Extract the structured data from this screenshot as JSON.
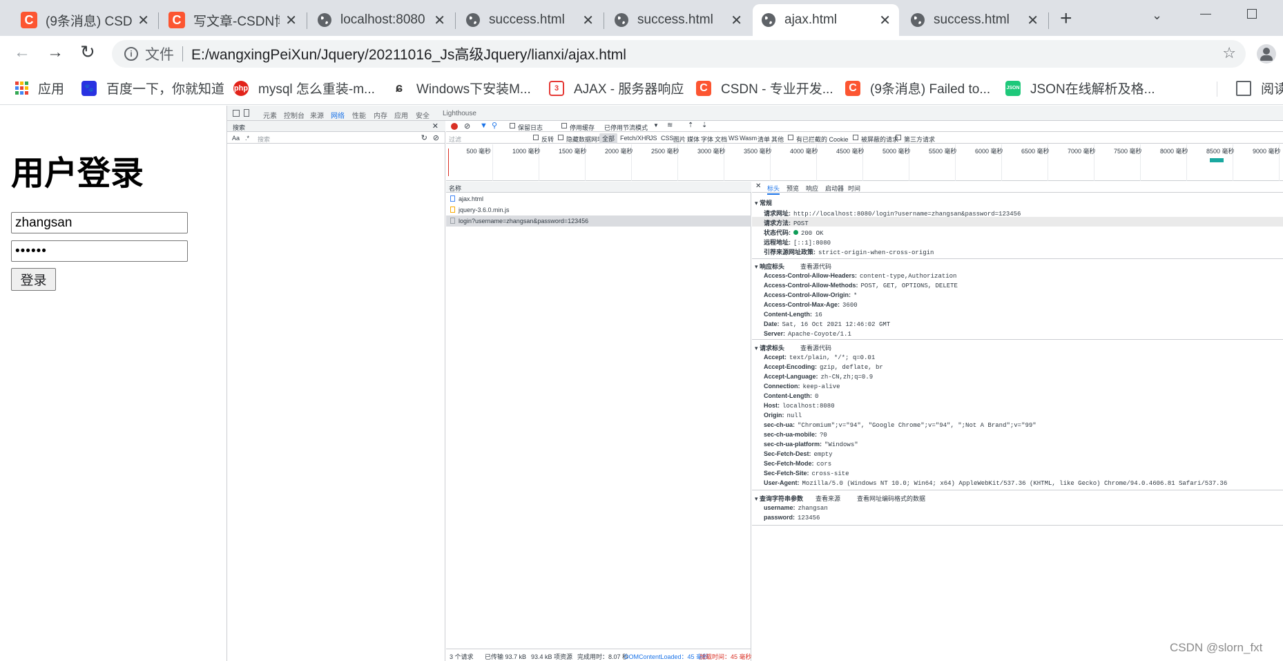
{
  "tabs": [
    {
      "title": "(9条消息) CSDN",
      "icon": "csdn-icon"
    },
    {
      "title": "写文章-CSDN博客",
      "icon": "csdn-icon"
    },
    {
      "title": "localhost:8080",
      "icon": "globe-icon"
    },
    {
      "title": "success.html",
      "icon": "globe-icon"
    },
    {
      "title": "success.html",
      "icon": "globe-icon"
    },
    {
      "title": "ajax.html",
      "icon": "globe-icon"
    },
    {
      "title": "success.html",
      "icon": "globe-icon"
    }
  ],
  "address": {
    "scheme_label": "文件",
    "url": "E:/wangxingPeiXun/Jquery/20211016_Js高级Jquery/lianxi/ajax.html"
  },
  "bookmarks": [
    {
      "label": "应用"
    },
    {
      "label": "百度一下，你就知道"
    },
    {
      "label": "mysql 怎么重装-m..."
    },
    {
      "label": "Windows下安装M..."
    },
    {
      "label": "AJAX - 服务器响应"
    },
    {
      "label": "CSDN - 专业开发..."
    },
    {
      "label": "(9条消息) Failed to..."
    },
    {
      "label": "JSON在线解析及格..."
    },
    {
      "label": "阅读"
    }
  ],
  "page": {
    "heading": "用户登录",
    "username": "zhangsan",
    "password": "••••••",
    "login_button": "登录"
  },
  "devtools": {
    "panels": [
      "元素",
      "控制台",
      "来源",
      "网络",
      "性能",
      "内存",
      "应用",
      "安全",
      "Lighthouse"
    ],
    "search_tab": "搜索",
    "search_case": "Aa",
    "search_regex": ".*",
    "search_placeholder": "搜索",
    "options": {
      "preserve_log": "保留日志",
      "disable_cache": "停用缓存",
      "throttle": "已停用节流模式"
    },
    "filter_placeholder": "过滤",
    "filter_types": {
      "invert": "反转",
      "hide_data": "隐藏数据网址",
      "all": "全部",
      "types": [
        "Fetch/XHR",
        "JS",
        "CSS",
        "图片",
        "媒体",
        "字体",
        "文档",
        "WS",
        "Wasm",
        "清单",
        "其他"
      ],
      "blocked_cookies": "有已拦截的 Cookie",
      "blocked_requests": "被屏蔽的请求",
      "third_party": "第三方请求"
    },
    "timeline_ticks": [
      "500 毫秒",
      "1000 毫秒",
      "1500 毫秒",
      "2000 毫秒",
      "2500 毫秒",
      "3000 毫秒",
      "3500 毫秒",
      "4000 毫秒",
      "4500 毫秒",
      "5000 毫秒",
      "5500 毫秒",
      "6000 毫秒",
      "6500 毫秒",
      "7000 毫秒",
      "7500 毫秒",
      "8000 毫秒",
      "8500 毫秒",
      "9000 毫秒"
    ],
    "requests_header": "名称",
    "requests": [
      "ajax.html",
      "jquery-3.6.0.min.js",
      "login?username=zhangsan&password=123456"
    ],
    "status_bar": [
      "3 个请求",
      "已传输 93.7 kB",
      "93.4 kB 项资源",
      "完成用时：8.07 秒",
      "DOMContentLoaded：45 毫秒",
      "加载时间：45 毫秒"
    ],
    "detail_tabs": [
      "标头",
      "预览",
      "响应",
      "启动器",
      "时间"
    ],
    "general": {
      "title": "常规",
      "rows": [
        {
          "k": "请求网址:",
          "v": "http://localhost:8080/login?username=zhangsan&password=123456"
        },
        {
          "k": "请求方法:",
          "v": "POST"
        },
        {
          "k": "状态代码:",
          "v": "200 OK"
        },
        {
          "k": "远程地址:",
          "v": "[::1]:8080"
        },
        {
          "k": "引荐来源网址政策:",
          "v": "strict-origin-when-cross-origin"
        }
      ]
    },
    "response_headers": {
      "title": "响应标头",
      "view_source": "查看源代码",
      "rows": [
        {
          "k": "Access-Control-Allow-Headers:",
          "v": "content-type,Authorization"
        },
        {
          "k": "Access-Control-Allow-Methods:",
          "v": "POST, GET, OPTIONS, DELETE"
        },
        {
          "k": "Access-Control-Allow-Origin:",
          "v": "*"
        },
        {
          "k": "Access-Control-Max-Age:",
          "v": "3600"
        },
        {
          "k": "Content-Length:",
          "v": "16"
        },
        {
          "k": "Date:",
          "v": "Sat, 16 Oct 2021 12:46:02 GMT"
        },
        {
          "k": "Server:",
          "v": "Apache-Coyote/1.1"
        }
      ]
    },
    "request_headers": {
      "title": "请求标头",
      "view_source": "查看源代码",
      "rows": [
        {
          "k": "Accept:",
          "v": "text/plain, */*; q=0.01"
        },
        {
          "k": "Accept-Encoding:",
          "v": "gzip, deflate, br"
        },
        {
          "k": "Accept-Language:",
          "v": "zh-CN,zh;q=0.9"
        },
        {
          "k": "Connection:",
          "v": "keep-alive"
        },
        {
          "k": "Content-Length:",
          "v": "0"
        },
        {
          "k": "Host:",
          "v": "localhost:8080"
        },
        {
          "k": "Origin:",
          "v": "null"
        },
        {
          "k": "sec-ch-ua:",
          "v": "\"Chromium\";v=\"94\", \"Google Chrome\";v=\"94\", \";Not A Brand\";v=\"99\""
        },
        {
          "k": "sec-ch-ua-mobile:",
          "v": "?0"
        },
        {
          "k": "sec-ch-ua-platform:",
          "v": "\"Windows\""
        },
        {
          "k": "Sec-Fetch-Dest:",
          "v": "empty"
        },
        {
          "k": "Sec-Fetch-Mode:",
          "v": "cors"
        },
        {
          "k": "Sec-Fetch-Site:",
          "v": "cross-site"
        },
        {
          "k": "User-Agent:",
          "v": "Mozilla/5.0 (Windows NT 10.0; Win64; x64) AppleWebKit/537.36 (KHTML, like Gecko) Chrome/94.0.4606.81 Safari/537.36"
        }
      ]
    },
    "query_params": {
      "title": "查询字符串参数",
      "view_source": "查看来源",
      "view_decoded": "查看网址编码格式的数据",
      "rows": [
        {
          "k": "username:",
          "v": "zhangsan"
        },
        {
          "k": "password:",
          "v": "123456"
        }
      ]
    }
  },
  "watermark": "CSDN @slorn_fxt"
}
